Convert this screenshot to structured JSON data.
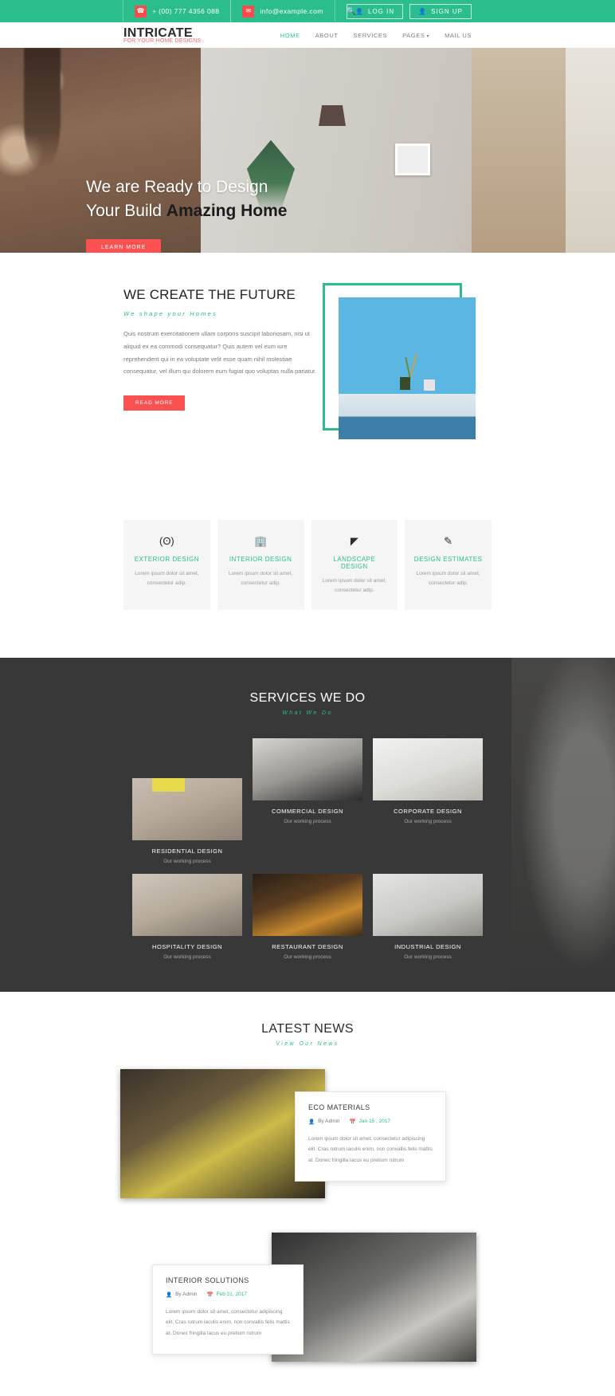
{
  "topbar": {
    "phone": "+ (00) 777 4356 088",
    "phone_icon": "phone-icon",
    "email": "info@example.com",
    "email_icon": "envelope-icon",
    "search_icon": "search-icon",
    "login_label": "LOG IN",
    "signup_label": "SIGN UP",
    "user_icon": "user-icon",
    "bg_color": "#2bbd8c"
  },
  "header": {
    "logo_main": "INTRICATE",
    "logo_sub": "FOR YOUR HOME DESIGNS",
    "logo_sub_color": "#fb6b78",
    "nav": [
      {
        "label": "HOME",
        "active": true
      },
      {
        "label": "ABOUT",
        "active": false
      },
      {
        "label": "SERVICES",
        "active": false
      },
      {
        "label": "PAGES",
        "active": false,
        "has_dropdown": true
      },
      {
        "label": "MAIL US",
        "active": false
      }
    ],
    "accent_color": "#2bbd8c"
  },
  "hero": {
    "line1": "We are Ready to Design",
    "line2_light": "Your Build ",
    "line2_bold": "Amazing Home",
    "button_label": "LEARN MORE",
    "button_color": "#fb5151",
    "dots": [
      {
        "active": false
      },
      {
        "active": false
      },
      {
        "active": true
      }
    ]
  },
  "about": {
    "heading": "WE CREATE THE FUTURE",
    "subheading": "We shape your Homes",
    "paragraph": "Quis nostrum exercitationem ullam corporis suscipit laboriosam, nisi ut aliquid ex ea commodi consequatur? Quis autem vel eum iure reprehenderit qui in ea voluptate velit esse quam nihil molestiae consequatur, vel illum qui dolorem eum fugiat quo voluptas nulla pariatur.",
    "button_label": "READ MORE",
    "frame_color": "#2bbd8c"
  },
  "features": [
    {
      "icon": "eye-icon",
      "glyph": "(ʘ)",
      "title": "EXTERIOR DESIGN",
      "text": "Lorem ipsum dolor sit amet, consectetur adip."
    },
    {
      "icon": "building-icon",
      "glyph": "🏢",
      "title": "INTERIOR DESIGN",
      "text": "Lorem ipsum dolor sit amet, consectetur adip."
    },
    {
      "icon": "leaf-icon",
      "glyph": "◤",
      "title": "LANDSCAPE DESIGN",
      "text": "Lorem ipsum dolor sit amet, consectetur adip."
    },
    {
      "icon": "pencil-square-icon",
      "glyph": "✎",
      "title": "DESIGN ESTIMATES",
      "text": "Lorem ipsum dolor sit amet, consectetur adip."
    }
  ],
  "services": {
    "title": "SERVICES WE DO",
    "subtitle": "What We Do",
    "items": [
      {
        "title": "RESIDENTIAL DESIGN",
        "caption": "Our working process"
      },
      {
        "title": "COMMERCIAL DESIGN",
        "caption": "Our working process"
      },
      {
        "title": "CORPORATE DESIGN",
        "caption": "Our working process"
      },
      {
        "title": "HOSPITALITY DESIGN",
        "caption": "Our working process"
      },
      {
        "title": "RESTAURANT DESIGN",
        "caption": "Our working process"
      },
      {
        "title": "INDUSTRIAL DESIGN",
        "caption": "Our working process"
      }
    ]
  },
  "news": {
    "title": "LATEST NEWS",
    "subtitle": "View Our News",
    "posts": [
      {
        "title": "ECO MATERIALS",
        "author_icon": "user-icon",
        "author": "By Admin",
        "calendar_icon": "calendar-icon",
        "date": "Jan 15 , 2017",
        "excerpt": "Lorem ipsum dolor sit amet, consectetur adipiscing elit. Cras rutrum iaculis enim, non convallis felis mattis at. Donec fringilla lacus eu pretium rutrum"
      },
      {
        "title": "INTERIOR SOLUTIONS",
        "author_icon": "user-icon",
        "author": "By Admin",
        "calendar_icon": "calendar-icon",
        "date": "Feb 21, 2017",
        "excerpt": "Lorem ipsum dolor sit amet, consectetur adipiscing elit. Cras rutrum iaculis enim, non convallis felis mattis at. Donec fringilla lacus eu pretium rutrum"
      }
    ]
  }
}
